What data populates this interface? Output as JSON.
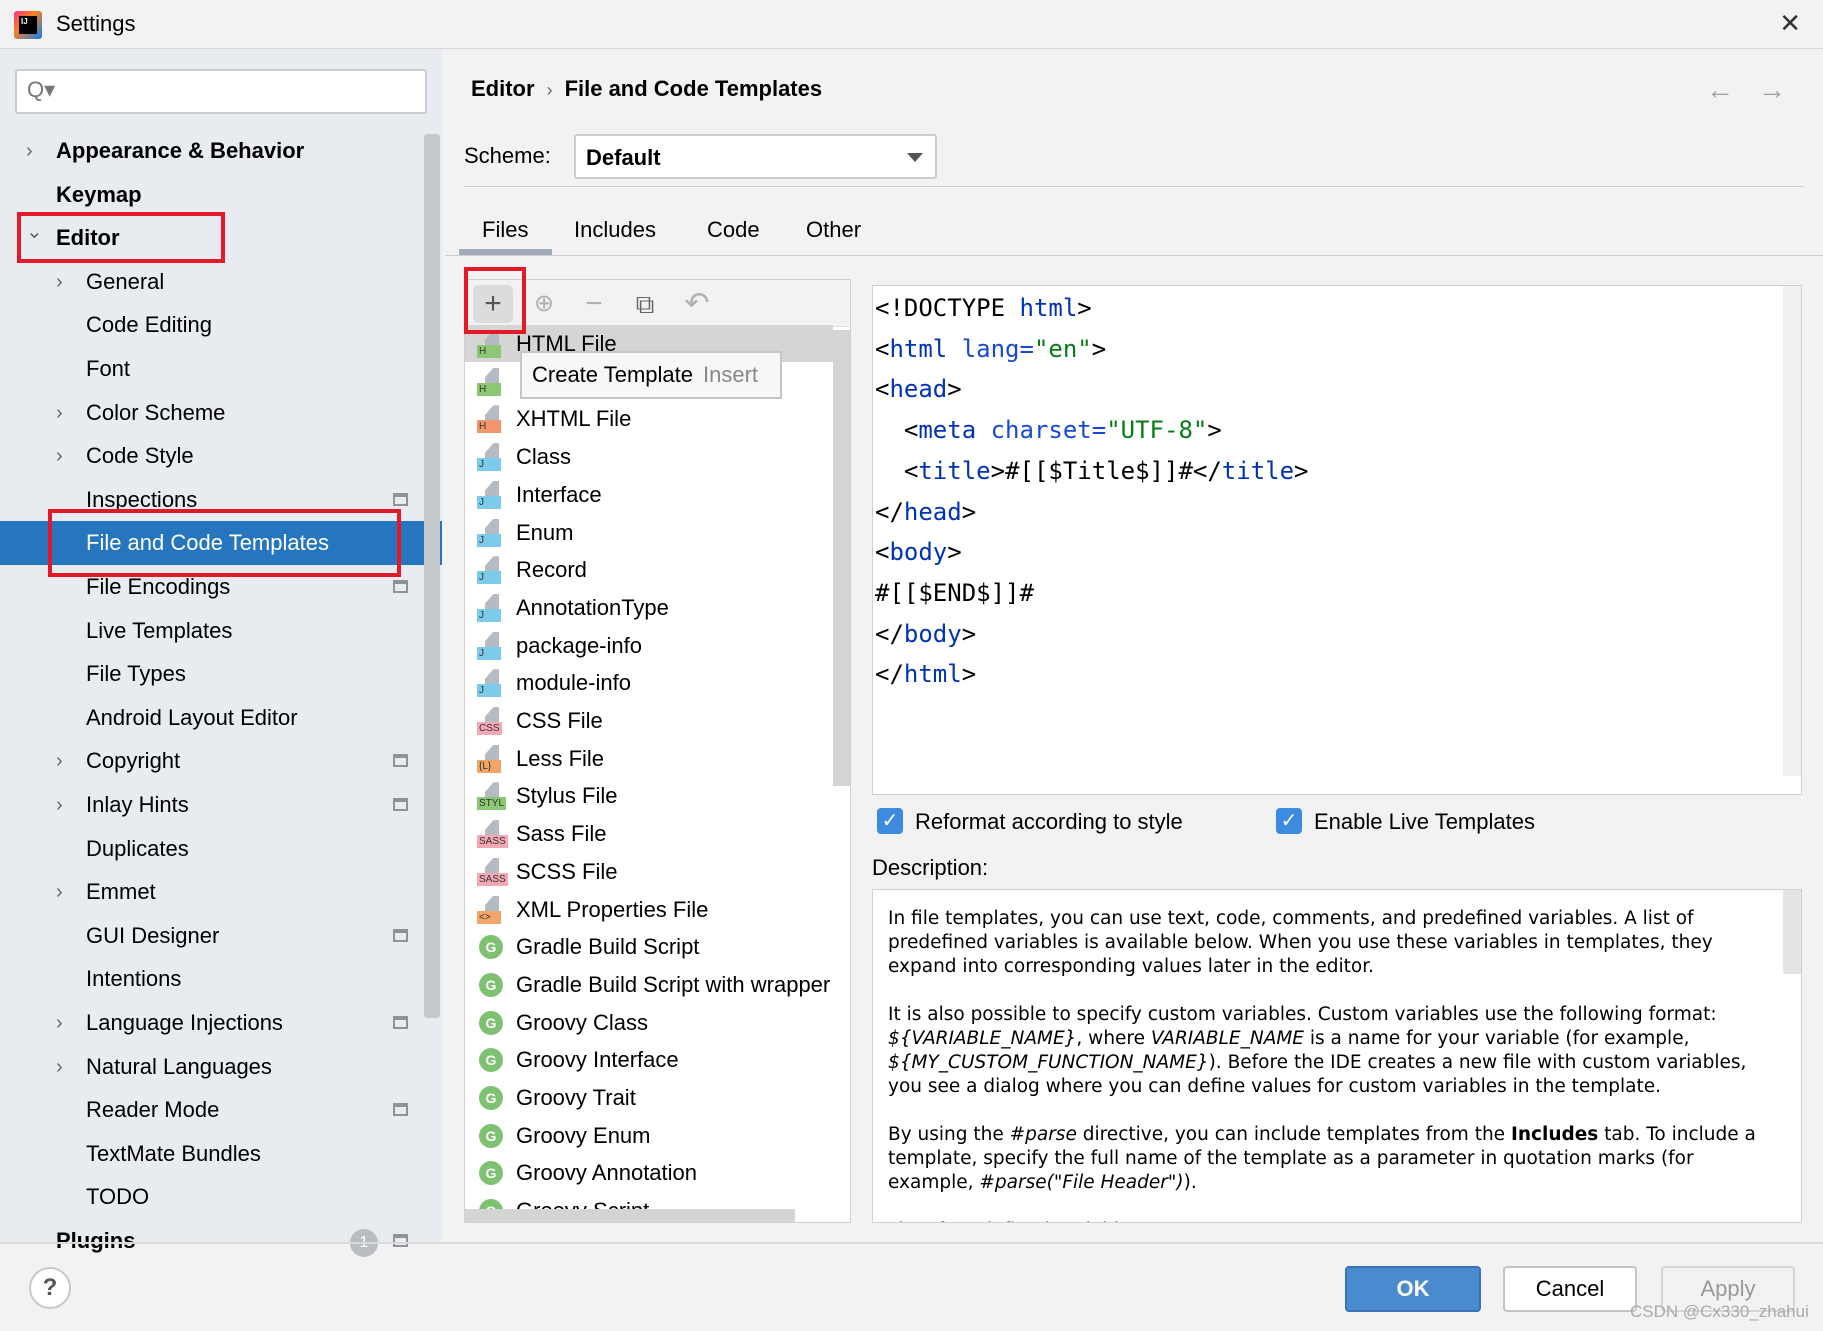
{
  "window": {
    "title": "Settings",
    "close": "✕"
  },
  "sidebar": {
    "search_icon": "Q▾",
    "items": [
      {
        "label": "Appearance & Behavior",
        "level": 0,
        "chevron": "right",
        "bold": true
      },
      {
        "label": "Keymap",
        "level": 0,
        "bold": true
      },
      {
        "label": "Editor",
        "level": 0,
        "chevron": "down",
        "bold": true
      },
      {
        "label": "General",
        "level": 1,
        "chevron": "right"
      },
      {
        "label": "Code Editing",
        "level": 1
      },
      {
        "label": "Font",
        "level": 1
      },
      {
        "label": "Color Scheme",
        "level": 1,
        "chevron": "right"
      },
      {
        "label": "Code Style",
        "level": 1,
        "chevron": "right"
      },
      {
        "label": "Inspections",
        "level": 1,
        "gear": true
      },
      {
        "label": "File and Code Templates",
        "level": 1,
        "selected": true
      },
      {
        "label": "File Encodings",
        "level": 1,
        "gear": true
      },
      {
        "label": "Live Templates",
        "level": 1
      },
      {
        "label": "File Types",
        "level": 1
      },
      {
        "label": "Android Layout Editor",
        "level": 1
      },
      {
        "label": "Copyright",
        "level": 1,
        "chevron": "right",
        "gear": true
      },
      {
        "label": "Inlay Hints",
        "level": 1,
        "chevron": "right",
        "gear": true
      },
      {
        "label": "Duplicates",
        "level": 1
      },
      {
        "label": "Emmet",
        "level": 1,
        "chevron": "right"
      },
      {
        "label": "GUI Designer",
        "level": 1,
        "gear": true
      },
      {
        "label": "Intentions",
        "level": 1
      },
      {
        "label": "Language Injections",
        "level": 1,
        "chevron": "right",
        "gear": true
      },
      {
        "label": "Natural Languages",
        "level": 1,
        "chevron": "right"
      },
      {
        "label": "Reader Mode",
        "level": 1,
        "gear": true
      },
      {
        "label": "TextMate Bundles",
        "level": 1
      },
      {
        "label": "TODO",
        "level": 1
      },
      {
        "label": "Plugins",
        "level": 0,
        "bold": true,
        "badge": "1",
        "gear": true
      }
    ]
  },
  "header": {
    "breadcrumb": [
      "Editor",
      "File and Code Templates"
    ],
    "back": "←",
    "forward": "→"
  },
  "scheme": {
    "label": "Scheme:",
    "value": "Default"
  },
  "tabs": [
    {
      "label": "Files",
      "active": true
    },
    {
      "label": "Includes"
    },
    {
      "label": "Code"
    },
    {
      "label": "Other"
    }
  ],
  "toolbar": {
    "create": "+",
    "create_child": "⊕",
    "remove": "−",
    "copy": "⧉",
    "reset": "↶"
  },
  "tooltip": {
    "text": "Create Template",
    "shortcut": "Insert"
  },
  "templates": [
    {
      "label": "HTML File",
      "badge": "H",
      "color": "#8cc873",
      "selected": true
    },
    {
      "label": "",
      "badge": "H",
      "color": "#8cc873"
    },
    {
      "label": "XHTML File",
      "badge": "H",
      "color": "#f2956a"
    },
    {
      "label": "Class",
      "badge": "J",
      "color": "#7ccbea"
    },
    {
      "label": "Interface",
      "badge": "J",
      "color": "#7ccbea"
    },
    {
      "label": "Enum",
      "badge": "J",
      "color": "#7ccbea"
    },
    {
      "label": "Record",
      "badge": "J",
      "color": "#7ccbea"
    },
    {
      "label": "AnnotationType",
      "badge": "J",
      "color": "#7ccbea"
    },
    {
      "label": "package-info",
      "badge": "J",
      "color": "#7ccbea"
    },
    {
      "label": "module-info",
      "badge": "J",
      "color": "#7ccbea"
    },
    {
      "label": "CSS File",
      "badge": "CSS",
      "color": "#f4a8b4"
    },
    {
      "label": "Less File",
      "badge": "{L}",
      "color": "#f2a66a"
    },
    {
      "label": "Stylus File",
      "badge": "STYL",
      "color": "#8cc873"
    },
    {
      "label": "Sass File",
      "badge": "SASS",
      "color": "#f4a8b4"
    },
    {
      "label": "SCSS File",
      "badge": "SASS",
      "color": "#f4a8b4"
    },
    {
      "label": "XML Properties File",
      "badge": "<>",
      "color": "#f2a66a"
    },
    {
      "label": "Gradle Build Script",
      "badge": "G",
      "round": true
    },
    {
      "label": "Gradle Build Script with wrapper",
      "badge": "G",
      "round": true
    },
    {
      "label": "Groovy Class",
      "badge": "G",
      "round": true
    },
    {
      "label": "Groovy Interface",
      "badge": "G",
      "round": true
    },
    {
      "label": "Groovy Trait",
      "badge": "G",
      "round": true
    },
    {
      "label": "Groovy Enum",
      "badge": "G",
      "round": true
    },
    {
      "label": "Groovy Annotation",
      "badge": "G",
      "round": true
    },
    {
      "label": "Groovy Script",
      "badge": "G",
      "round": true
    }
  ],
  "code": [
    [
      [
        "<!DOCTYPE ",
        ""
      ],
      [
        "html",
        "tag"
      ],
      [
        ">",
        ""
      ]
    ],
    [
      [
        "<",
        ""
      ],
      [
        "html",
        "tag"
      ],
      [
        " lang=",
        "attr"
      ],
      [
        "\"en\"",
        "val"
      ],
      [
        ">",
        ""
      ]
    ],
    [
      [
        "<",
        ""
      ],
      [
        "head",
        "tag"
      ],
      [
        ">",
        ""
      ]
    ],
    [
      [
        "  <",
        ""
      ],
      [
        "meta",
        "tag"
      ],
      [
        " charset=",
        "attr"
      ],
      [
        "\"UTF-8\"",
        "val"
      ],
      [
        ">",
        ""
      ]
    ],
    [
      [
        "  <",
        ""
      ],
      [
        "title",
        "tag"
      ],
      [
        ">#[[$Title$]]#</",
        ""
      ],
      [
        "title",
        "tag"
      ],
      [
        ">",
        ""
      ]
    ],
    [
      [
        "</",
        ""
      ],
      [
        "head",
        "tag"
      ],
      [
        ">",
        ""
      ]
    ],
    [
      [
        "<",
        ""
      ],
      [
        "body",
        "tag"
      ],
      [
        ">",
        ""
      ]
    ],
    [
      [
        "#[[$END$]]#",
        ""
      ]
    ],
    [
      [
        "</",
        ""
      ],
      [
        "body",
        "tag"
      ],
      [
        ">",
        ""
      ]
    ],
    [
      [
        "</",
        ""
      ],
      [
        "html",
        "tag"
      ],
      [
        ">",
        ""
      ]
    ]
  ],
  "options": {
    "reformat": {
      "label": "Reformat according to style",
      "checked": true
    },
    "live_templates": {
      "label": "Enable Live Templates",
      "checked": true
    }
  },
  "description": {
    "label": "Description:",
    "paragraphs": [
      [
        [
          "In file templates, you can use text, code, comments, and predefined variables. A list of predefined variables is available below. When you use these variables in templates, they expand into corresponding values later in the editor.",
          ""
        ]
      ],
      [
        [
          "It is also possible to specify custom variables. Custom variables use the following format: ",
          ""
        ],
        [
          "${VARIABLE_NAME}",
          "i"
        ],
        [
          ", where ",
          ""
        ],
        [
          "VARIABLE_NAME",
          "i"
        ],
        [
          " is a name for your variable (for example, ",
          ""
        ],
        [
          "${MY_CUSTOM_FUNCTION_NAME}",
          "i"
        ],
        [
          "). Before the IDE creates a new file with custom variables, you see a dialog where you can define values for custom variables in the template.",
          ""
        ]
      ],
      [
        [
          "By using the ",
          ""
        ],
        [
          "#parse",
          "i"
        ],
        [
          " directive, you can include templates from the ",
          ""
        ],
        [
          "Includes",
          "b"
        ],
        [
          " tab. To include a template, specify the full name of the template as a parameter in quotation marks (for example, ",
          ""
        ],
        [
          "#parse(\"File Header\")",
          "i"
        ],
        [
          ").",
          ""
        ]
      ],
      [
        [
          "List of predefined variables",
          ""
        ]
      ]
    ]
  },
  "buttons": {
    "ok": "OK",
    "cancel": "Cancel",
    "apply": "Apply",
    "help": "?"
  },
  "watermark": "CSDN @Cx330_zhahui",
  "colors": {
    "selection": "#2675bf",
    "ok": "#4a8bd0",
    "highlight_box": "#e3192a",
    "tag": "#0033b3",
    "string": "#067d17"
  }
}
